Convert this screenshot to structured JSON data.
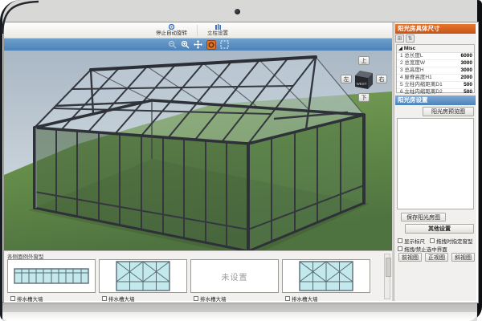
{
  "toolbar": {
    "buttons": [
      {
        "label": "停止自动旋转"
      },
      {
        "label": "立柱设置"
      }
    ]
  },
  "viewport": {
    "icons": [
      "zoom-out",
      "zoom-in",
      "pan",
      "rotate-selected",
      "marquee-select"
    ],
    "nav_cube": {
      "up": "上",
      "down": "下",
      "left": "左",
      "right": "右",
      "face": "WEST"
    }
  },
  "right_panel": {
    "title": "阳光房具体尺寸",
    "category": "Misc",
    "rows": [
      {
        "label": "1 总长度L",
        "value": "6000"
      },
      {
        "label": "2 总宽度W",
        "value": "3000"
      },
      {
        "label": "3 总高度H",
        "value": "3000"
      },
      {
        "label": "4 屋脊高度H1",
        "value": "2000"
      },
      {
        "label": "5 立柱内缩距离D1",
        "value": "500"
      },
      {
        "label": "6 立柱内缩距离D2",
        "value": "500"
      }
    ],
    "settings_title": "阳光房设置",
    "preview_button": "阳光房预览图",
    "save_button": "保存阳光房图",
    "other_settings_title": "其他设置",
    "checkboxes": [
      "显示标尺",
      "拖拽时指定窗型",
      "拖拽/禁止选中界面"
    ],
    "view_buttons": [
      "前视图",
      "正视图",
      "斜视图"
    ]
  },
  "bottom_panel": {
    "header": "各侧面例外窗型",
    "cards": [
      {
        "type": "window-grid",
        "checkbox_label": "排水槽大墙"
      },
      {
        "type": "folding-door",
        "checkbox_label": "排水槽大墙"
      },
      {
        "type": "empty",
        "label": "未设置",
        "checkbox_label": "排水槽大墙"
      },
      {
        "type": "folding-door",
        "checkbox_label": "排水槽大墙"
      }
    ]
  },
  "colors": {
    "panel_title_orange": "#d2611e",
    "panel_title_blue": "#5e93c7",
    "viewport_bar_blue": "#5188bd",
    "grass_green": "#648c49",
    "frame_charcoal": "#34383e",
    "glass_cyan": "#c3e9ec",
    "rotate_icon_orange": "#e2742b"
  }
}
